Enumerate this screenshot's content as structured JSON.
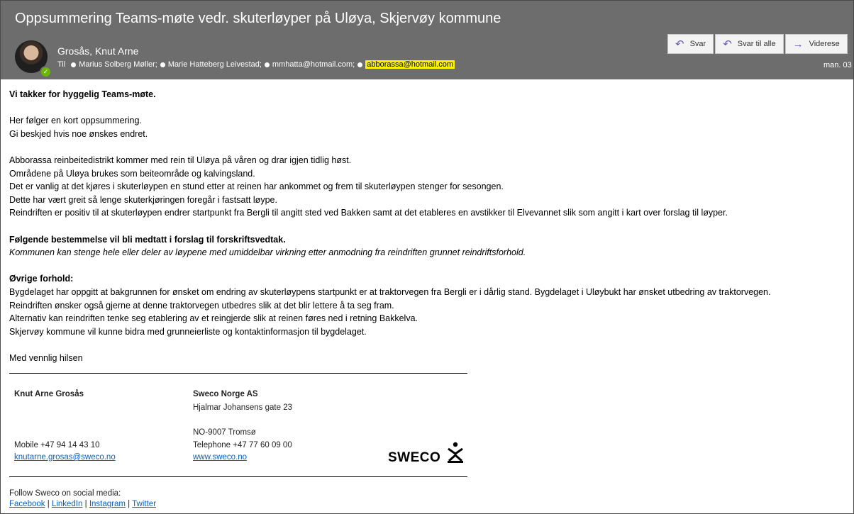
{
  "header": {
    "subject": "Oppsummering Teams-møte vedr. skuterløyper på Uløya, Skjervøy kommune",
    "sender": "Grosås, Knut Arne",
    "to_label": "Til",
    "recipients": [
      "Marius Solberg Møller;",
      "Marie Hatteberg Leivestad;",
      "mmhatta@hotmail.com;",
      "abborassa@hotmail.com"
    ],
    "date": "man. 03",
    "buttons": {
      "reply": "Svar",
      "reply_all": "Svar til alle",
      "forward": "Viderese"
    },
    "icons": {
      "reply": "reply-icon",
      "reply_all": "reply-all-icon",
      "forward": "forward-icon"
    }
  },
  "body": {
    "greeting": "Vi takker for hyggelig Teams-møte.",
    "p1": [
      "Her følger en kort oppsummering.",
      "Gi beskjed hvis noe ønskes endret."
    ],
    "p2": [
      "Abborassa reinbeitedistrikt kommer med rein til Uløya på våren og drar igjen tidlig høst.",
      "Områdene på Uløya brukes som beiteområde og kalvingsland.",
      "Det er vanlig at det kjøres i skuterløypen en stund etter at reinen har ankommet og frem til skuterløypen stenger for sesongen.",
      "Dette har vært greit så lenge skuterkjøringen foregår i fastsatt løype.",
      "Reindriften er positiv til at skuterløypen endrer startpunkt fra Bergli til angitt sted ved Bakken samt at det etableres en avstikker til Elvevannet slik som angitt i kart over forslag til løyper."
    ],
    "provision_heading": "Følgende bestemmelse vil bli medtatt i forslag til forskriftsvedtak.",
    "provision_text": "Kommunen kan stenge hele eller deler av løypene med umiddelbar virkning etter anmodning fra reindriften grunnet reindriftsforhold.",
    "other_heading": "Øvrige forhold:",
    "p3": [
      "Bygdelaget har oppgitt at bakgrunnen for ønsket om endring av skuterløypens startpunkt er at traktorvegen fra Bergli er i dårlig stand. Bygdelaget i Uløybukt har ønsket utbedring av traktorvegen.",
      "Reindriften ønsker også gjerne at denne traktorvegen utbedres slik at det blir lettere å ta seg fram.",
      "Alternativ kan reindriften tenke seg etablering av et reingjerde slik at reinen føres ned i retning Bakkelva.",
      "Skjervøy kommune vil kunne bidra med grunneierliste og kontaktinformasjon til bygdelaget."
    ],
    "closing": "Med vennlig hilsen"
  },
  "signature": {
    "name": "Knut Arne Grosås",
    "mobile": "Mobile +47 94 14 43 10",
    "email": "knutarne.grosas@sweco.no",
    "company": "Sweco Norge AS",
    "address1": "Hjalmar Johansens gate 23",
    "address2": "NO-9007 Tromsø",
    "telephone": "Telephone +47 77 60 09 00",
    "web": "www.sweco.no",
    "logo_text": "SWECO"
  },
  "social": {
    "label": "Follow Sweco on social media:",
    "links": [
      "Facebook",
      "LinkedIn",
      "Instagram",
      "Twitter"
    ],
    "separator": "|"
  }
}
